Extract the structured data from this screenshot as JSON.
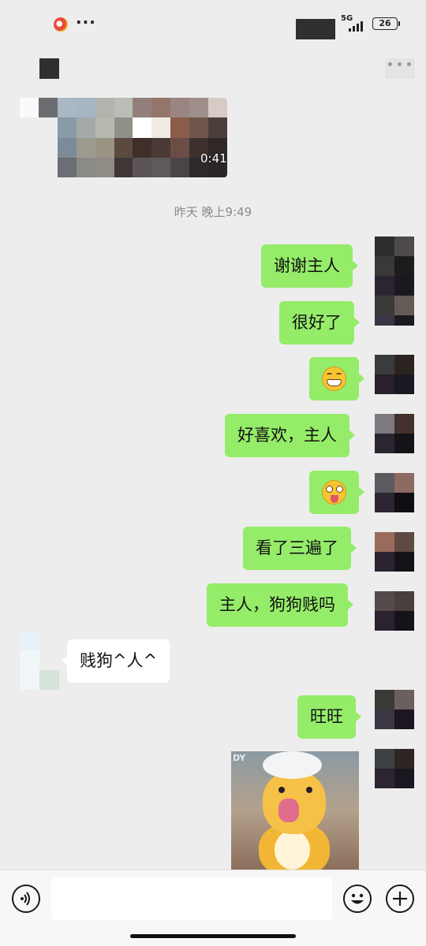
{
  "status_bar": {
    "network": "5G",
    "battery": "26"
  },
  "video": {
    "duration": "0:41"
  },
  "timestamp": "昨天 晚上9:49",
  "messages": [
    {
      "type": "text",
      "text": "谢谢主人"
    },
    {
      "type": "text",
      "text": "很好了"
    },
    {
      "type": "emoji",
      "icon": "grinning-emoji-icon"
    },
    {
      "type": "text",
      "text": "好喜欢，主人"
    },
    {
      "type": "emoji",
      "icon": "tongue-out-emoji-icon"
    },
    {
      "type": "text",
      "text": "看了三遍了"
    },
    {
      "type": "text",
      "text": "主人，狗狗贱吗"
    },
    {
      "type": "text",
      "text": "贱狗^人^"
    },
    {
      "type": "text",
      "text": "旺旺"
    },
    {
      "type": "sticker",
      "icon": "yellow-creature-sticker",
      "tag": "DY"
    }
  ],
  "input_bar": {
    "voice_icon": "voice-icon",
    "emoji_icon": "emoji-icon",
    "plus_icon": "plus-icon",
    "input_value": ""
  },
  "colors": {
    "background": "#ededed",
    "my_bubble": "#95ec69",
    "their_bubble": "#ffffff"
  }
}
